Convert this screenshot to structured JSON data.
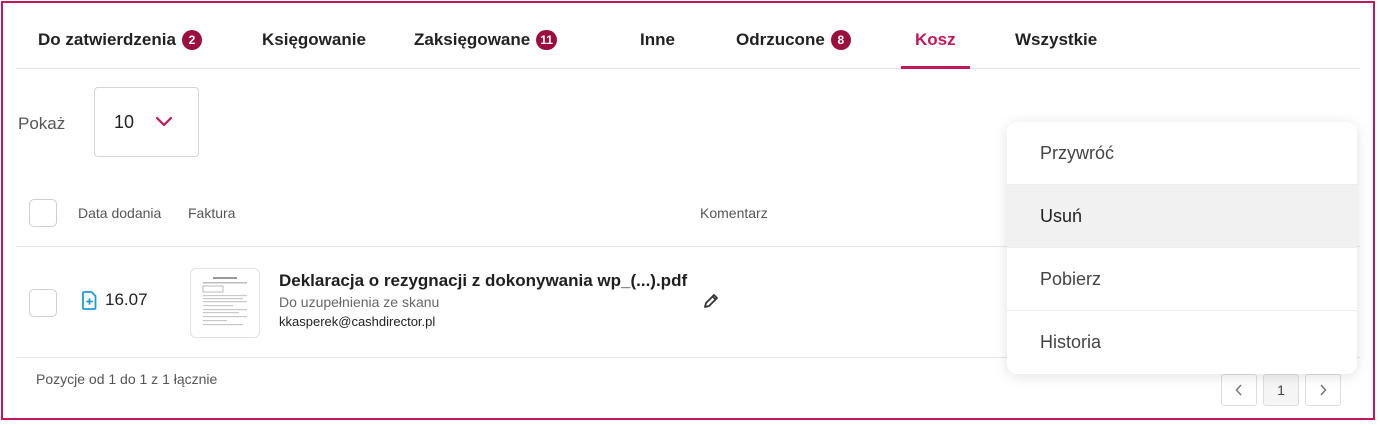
{
  "tabs": [
    {
      "label": "Do zatwierdzenia",
      "badge": "2"
    },
    {
      "label": "Księgowanie",
      "badge": null
    },
    {
      "label": "Zaksięgowane",
      "badge": "11"
    },
    {
      "label": "Inne",
      "badge": null
    },
    {
      "label": "Odrzucone",
      "badge": "8"
    },
    {
      "label": "Kosz",
      "badge": null,
      "active": true
    },
    {
      "label": "Wszystkie",
      "badge": null
    }
  ],
  "show": {
    "label": "Pokaż",
    "value": "10"
  },
  "table": {
    "headers": {
      "date": "Data dodania",
      "invoice": "Faktura",
      "comment": "Komentarz"
    },
    "rows": [
      {
        "date": "16.07",
        "file_name": "Deklaracja o rezygnacji z dokonywania wp_(...).pdf",
        "status": "Do uzupełnienia ze skanu",
        "email": "kkasperek@cashdirector.pl"
      }
    ]
  },
  "footer": {
    "summary": "Pozycje od 1 do 1 z 1 łącznie",
    "page": "1"
  },
  "context_menu": {
    "items": [
      "Przywróć",
      "Usuń",
      "Pobierz",
      "Historia"
    ],
    "highlighted": "Usuń"
  },
  "colors": {
    "accent": "#c2185b",
    "badge": "#9b0f3f",
    "file_icon": "#1e9bd7"
  }
}
